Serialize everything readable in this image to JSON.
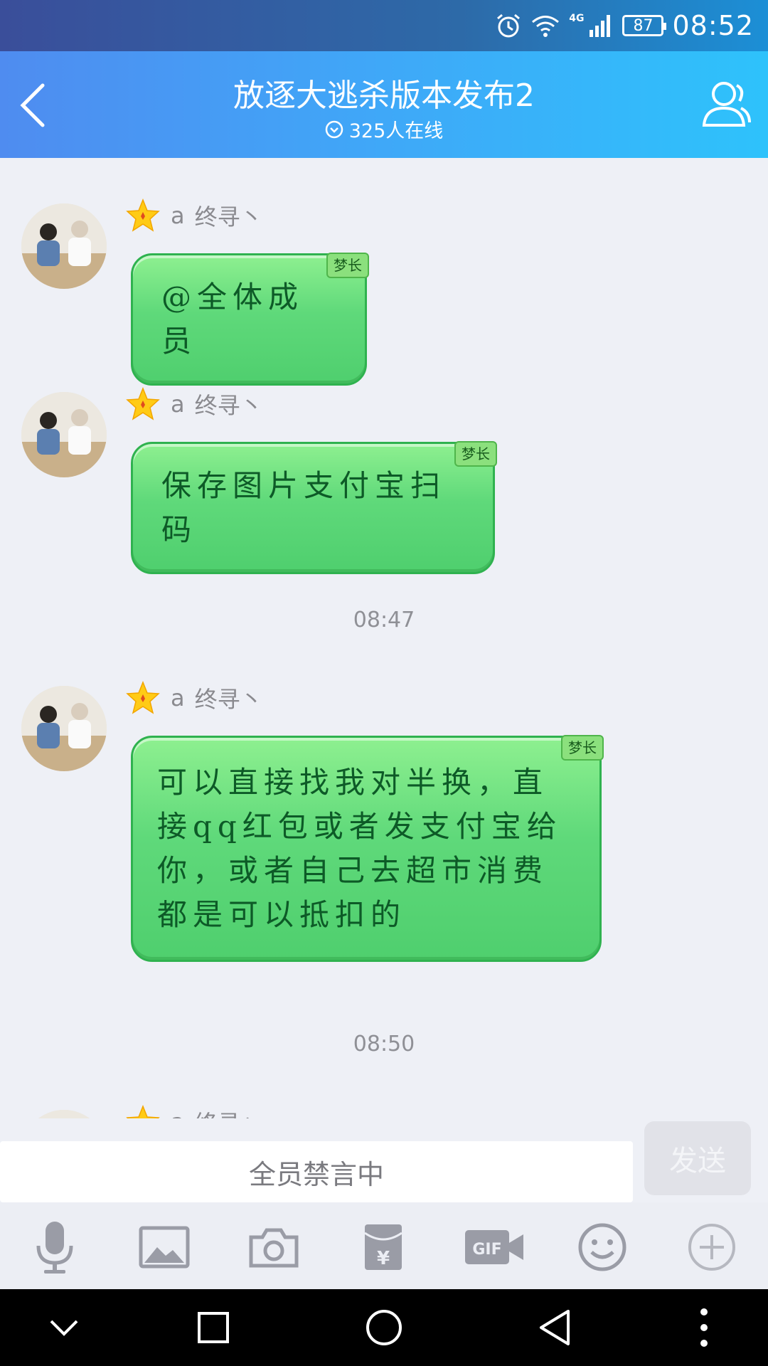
{
  "status_bar": {
    "network": "4G",
    "battery": "87",
    "time": "08:52"
  },
  "header": {
    "title": "放逐大逃杀版本发布2",
    "online": "325人在线"
  },
  "messages": [
    {
      "sender_prefix": "a",
      "sender_name": "终寻丶",
      "badge": "梦长",
      "text": "@全体成员"
    },
    {
      "sender_prefix": "a",
      "sender_name": "终寻丶",
      "badge": "梦长",
      "text": "保存图片支付宝扫码"
    },
    {
      "sender_prefix": "a",
      "sender_name": "终寻丶",
      "badge": "梦长",
      "text": "可以直接找我对半换，直接qq红包或者发支付宝给你，或者自己去超市消费都是可以抵扣的"
    },
    {
      "sender_prefix": "a",
      "sender_name": "终寻丶"
    }
  ],
  "time_dividers": [
    "08:47",
    "08:50"
  ],
  "input": {
    "placeholder": "全员禁言中",
    "send_label": "发送"
  },
  "toolbar": {
    "icons": [
      "microphone-icon",
      "image-icon",
      "camera-icon",
      "red-packet-icon",
      "gif-icon",
      "emoji-icon",
      "plus-icon"
    ]
  },
  "colors": {
    "header_start": "#4f8cf0",
    "header_end": "#2ec2fb",
    "bubble_green": "#5fd97a",
    "bubble_border": "#2fb24f",
    "bubble_text": "#0d5a27"
  }
}
